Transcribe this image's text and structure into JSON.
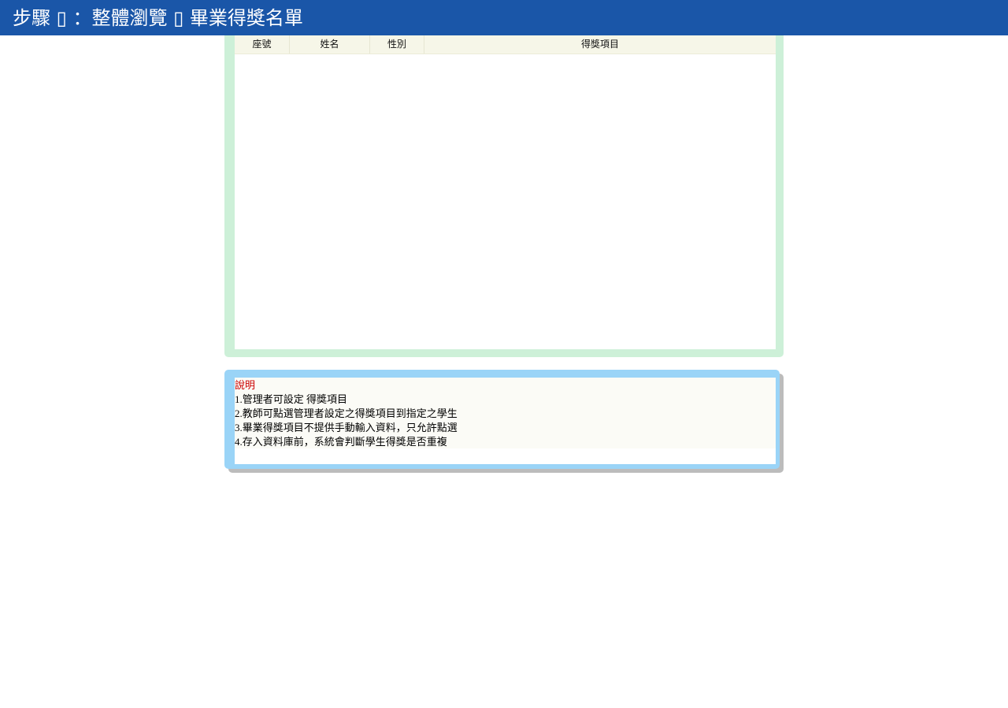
{
  "header": {
    "title": "步驟 ▯ ：整體瀏覽 ▯ 畢業得獎名單"
  },
  "grid": {
    "columns": [
      "座號",
      "姓名",
      "性別",
      "得獎項目"
    ],
    "rows": []
  },
  "description": {
    "title": "說明",
    "lines": [
      "1.管理者可設定 得獎項目",
      "2.教師可點選管理者設定之得獎項目到指定之學生",
      "3.畢業得獎項目不提供手動輸入資料，只允許點選",
      "4.存入資料庫前，系統會判斷學生得獎是否重複"
    ]
  },
  "colors": {
    "header_bg": "#1a56a8",
    "grid_frame": "#cdf0d8",
    "desc_frame": "#9ad4f7",
    "desc_title": "#cc0000"
  }
}
